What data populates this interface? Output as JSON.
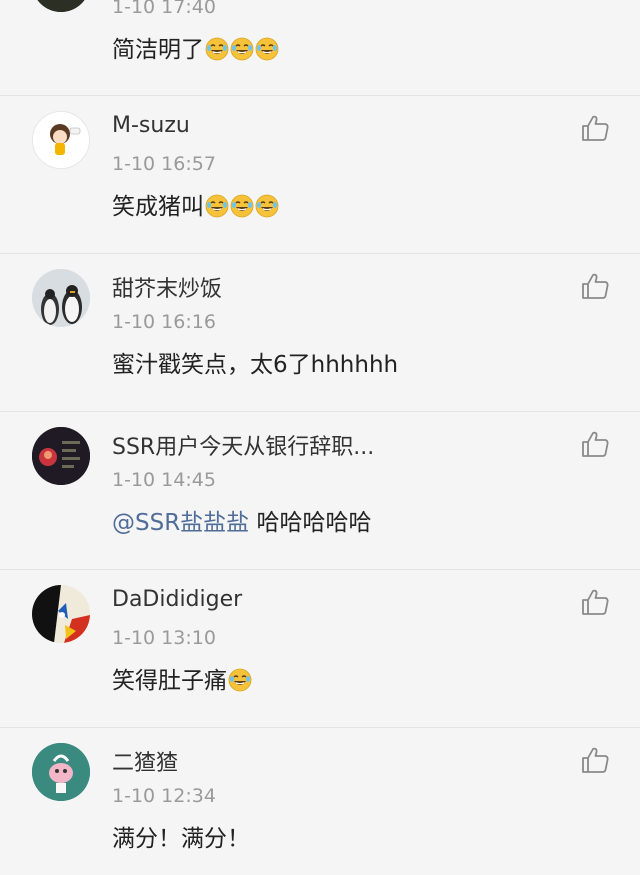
{
  "comments": [
    {
      "time": "1-10 17:40",
      "text": "简洁明了",
      "emoji_icon": "laughing-tears-emoji",
      "emoji_count": 3
    },
    {
      "username": "M-suzu",
      "time": "1-10 16:57",
      "text": "笑成猪叫",
      "emoji_icon": "laughing-tears-emoji",
      "emoji_count": 3
    },
    {
      "username": "甜芥末炒饭",
      "time": "1-10 16:16",
      "text": "蜜汁戳笑点，太6了hhhhhh"
    },
    {
      "username": "SSR用户今天从银行辞职...",
      "time": "1-10 14:45",
      "mention": "@SSR盐盐盐",
      "text": " 哈哈哈哈哈"
    },
    {
      "username": "DaDididiger",
      "time": "1-10 13:10",
      "text": "笑得肚子痛",
      "emoji_icon": "laughing-tears-emoji",
      "emoji_count": 1
    },
    {
      "username": "二猹猹",
      "time": "1-10 12:34",
      "text": "满分！满分！"
    }
  ],
  "icons": {
    "like": "thumbs-up-icon"
  },
  "colors": {
    "background": "#f5f5f5",
    "mention": "#4f6d98",
    "timestamp": "#9a9a9a",
    "divider": "#e4e4e4"
  }
}
